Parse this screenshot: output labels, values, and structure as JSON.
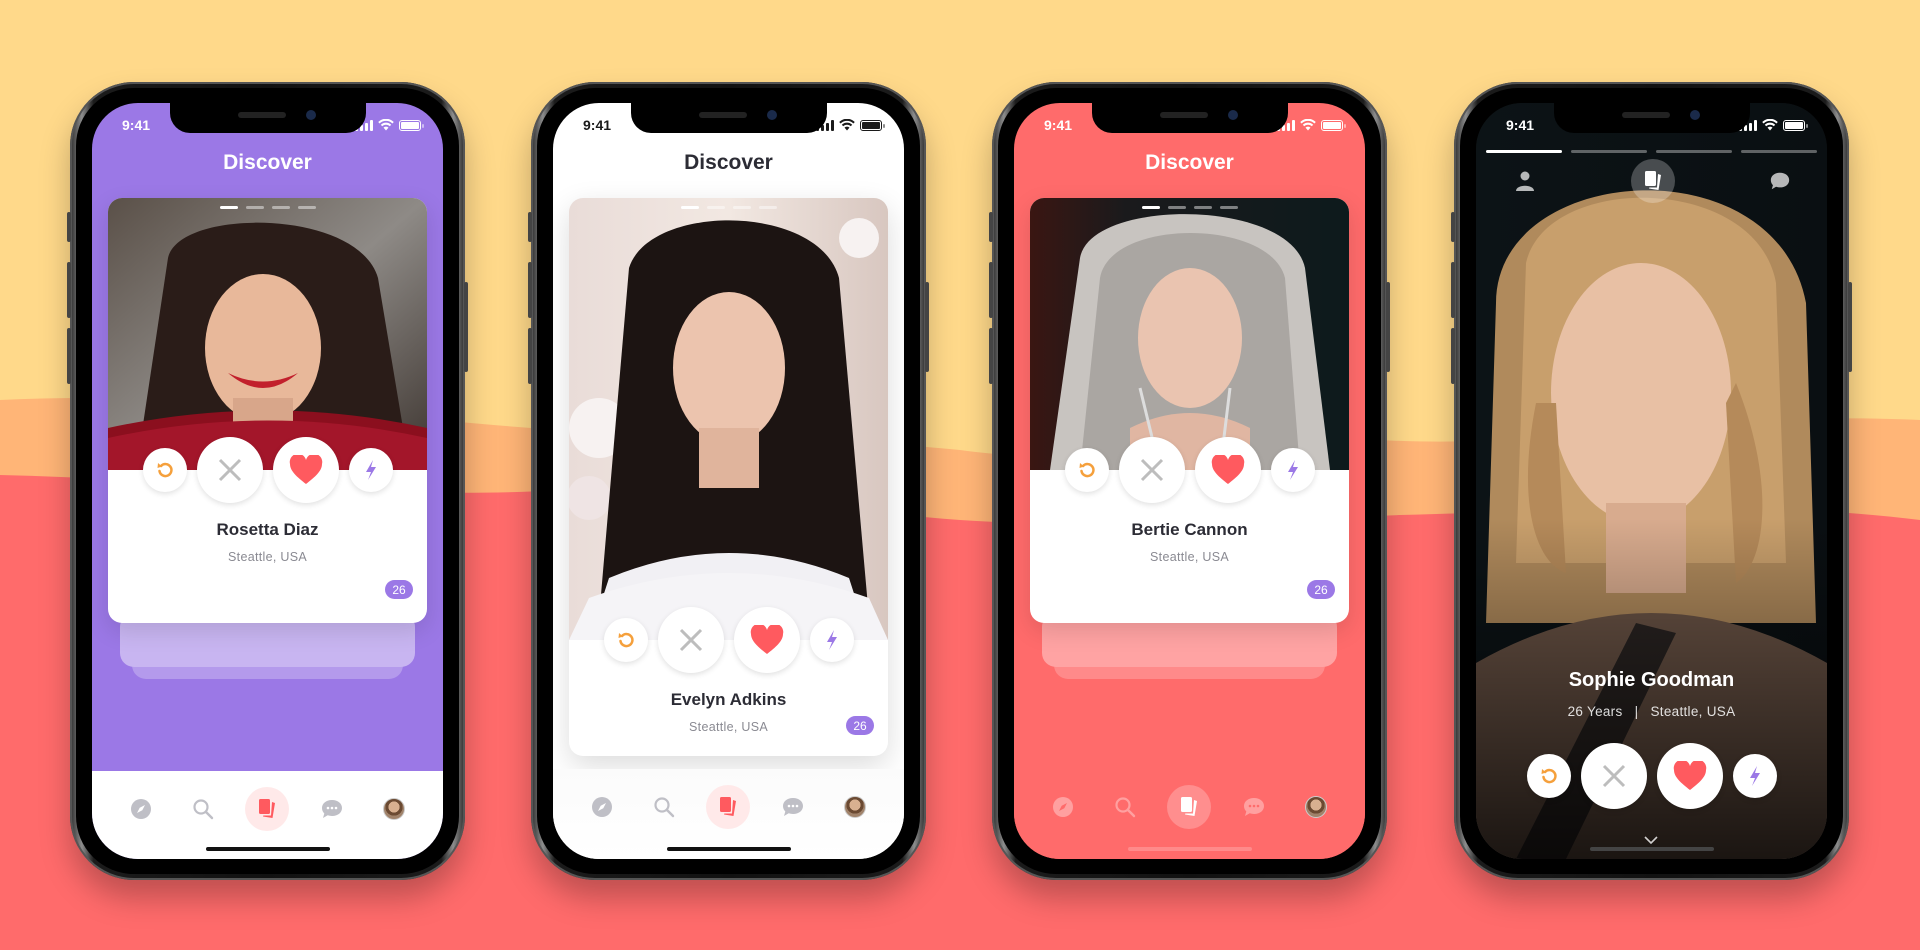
{
  "colors": {
    "bg_top": "#FFD98A",
    "wave_mid": "#FFB577",
    "wave_bottom": "#FF6B6B",
    "purple": "#9B78E6",
    "coral": "#FF6B6B",
    "white": "#FFFFFF",
    "dark": "#0d0d0f",
    "undo_orange": "#F5A03C",
    "heart_red": "#FF5A5F",
    "bolt_purple": "#9B78E6",
    "x_gray": "#BDBDBD",
    "age_badge": "#9B78E6"
  },
  "phones": [
    {
      "theme": "purple",
      "status": {
        "time": "9:41"
      },
      "title": "Discover",
      "profile": {
        "name": "Rosetta Diaz",
        "location": "Steattle, USA",
        "age": "26"
      },
      "photo_dots": {
        "count": 4,
        "active": 0
      },
      "actions": [
        "undo-icon",
        "close-icon",
        "heart-icon",
        "bolt-icon"
      ],
      "nav": [
        "compass-icon",
        "search-icon",
        "cards-icon",
        "chat-icon",
        "avatar"
      ],
      "active_nav": 2
    },
    {
      "theme": "white",
      "status": {
        "time": "9:41"
      },
      "title": "Discover",
      "profile": {
        "name": "Evelyn Adkins",
        "location": "Steattle, USA",
        "age": "26"
      },
      "photo_dots": {
        "count": 4,
        "active": 0
      },
      "actions": [
        "undo-icon",
        "close-icon",
        "heart-icon",
        "bolt-icon"
      ],
      "nav": [
        "compass-icon",
        "search-icon",
        "cards-icon",
        "chat-icon",
        "avatar"
      ],
      "active_nav": 2
    },
    {
      "theme": "coral",
      "status": {
        "time": "9:41"
      },
      "title": "Discover",
      "profile": {
        "name": "Bertie Cannon",
        "location": "Steattle, USA",
        "age": "26"
      },
      "photo_dots": {
        "count": 4,
        "active": 0
      },
      "actions": [
        "undo-icon",
        "close-icon",
        "heart-icon",
        "bolt-icon"
      ],
      "nav": [
        "compass-icon",
        "search-icon",
        "cards-icon",
        "chat-icon",
        "avatar"
      ],
      "active_nav": 2
    },
    {
      "theme": "dark-fullscreen",
      "status": {
        "time": "9:41"
      },
      "profile": {
        "name": "Sophie Goodman",
        "age_label": "26 Years",
        "separator": "|",
        "location": "Steattle, USA"
      },
      "photo_progress": {
        "count": 4,
        "active": 0
      },
      "top_nav": [
        "profile-icon",
        "cards-icon",
        "chat-icon"
      ],
      "active_top_nav": 1,
      "actions": [
        "undo-icon",
        "close-icon",
        "heart-icon",
        "bolt-icon"
      ],
      "more_icon": "chevron-down-icon"
    }
  ]
}
